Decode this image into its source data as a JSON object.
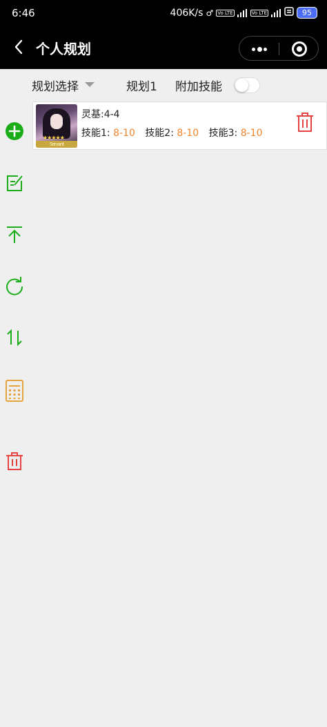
{
  "status_bar": {
    "time": "6:46",
    "net_speed": "406K/s",
    "volte1": "Vo LTE",
    "volte2": "Vo LTE",
    "battery": "95"
  },
  "nav": {
    "title": "个人规划",
    "back_icon": "chevron-left-icon",
    "more_icon": "more-dots-icon",
    "close_icon": "target-close-icon"
  },
  "filter": {
    "plan_select_label": "规划选择",
    "plan_name": "规划1",
    "extra_skill_label": "附加技能",
    "extra_skill_enabled": false
  },
  "sidebar": {
    "items": [
      {
        "icon": "add-circle-icon",
        "color": "#1aad19"
      },
      {
        "icon": "edit-icon",
        "color": "#1aad19"
      },
      {
        "icon": "move-to-top-icon",
        "color": "#1aad19"
      },
      {
        "icon": "refresh-icon",
        "color": "#1aad19"
      },
      {
        "icon": "sort-icon",
        "color": "#1aad19"
      },
      {
        "icon": "calculator-icon",
        "color": "#e6a23c"
      },
      {
        "icon": "trash-icon",
        "color": "#e64340"
      }
    ]
  },
  "cards": [
    {
      "ascension_label": "灵基:4-4",
      "skills": [
        {
          "label": "技能1:",
          "value": "8-10"
        },
        {
          "label": "技能2:",
          "value": "8-10"
        },
        {
          "label": "技能3:",
          "value": "8-10"
        }
      ],
      "avatar_badge": "Servant",
      "avatar_stars": "★★★★★",
      "delete_icon": "trash-icon"
    }
  ],
  "colors": {
    "accent_green": "#1aad19",
    "value_orange": "#f0852d",
    "delete_red": "#e64340",
    "calculator_orange": "#e6a23c"
  }
}
